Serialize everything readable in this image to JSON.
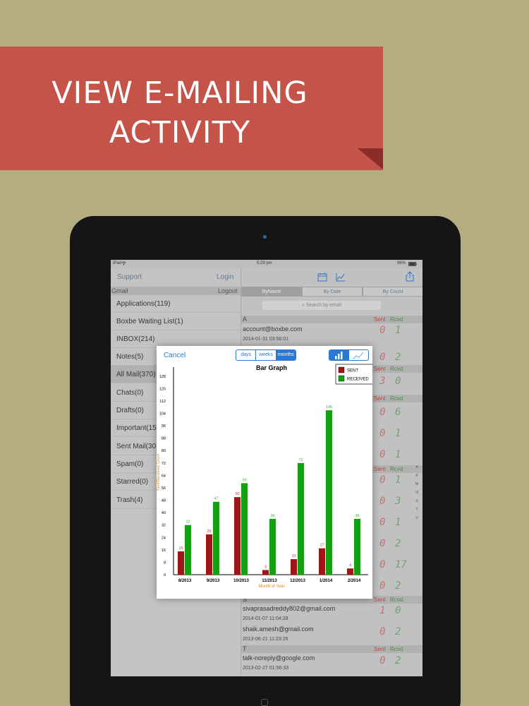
{
  "banner": {
    "line1": "VIEW E-MAILING",
    "line2": "ACTIVITY"
  },
  "status": {
    "device": "iPad",
    "time": "5:29 pm",
    "battery": "96%"
  },
  "left": {
    "support": "Support",
    "login": "Login",
    "account": "Gmail",
    "logout": "Logout",
    "folders": [
      "Applications(119)",
      "Boxbe Waiting List(1)",
      "INBOX(214)",
      "Notes(5)",
      "All Mail(370)",
      "Chats(0)",
      "Drafts(0)",
      "Important(15",
      "Sent Mail(30",
      "Spam(0)",
      "Starred(0)",
      "Trash(4)"
    ]
  },
  "right": {
    "tabs": [
      "ByName",
      "By Date",
      "By Count"
    ],
    "search_placeholder": "Search by email",
    "sent_label": "Sent",
    "rcvd_label": "Rcvd",
    "sections": [
      {
        "letter": "A",
        "email": "account@boxbe.com",
        "date": "2014-01-31 03:56:01",
        "sent": "0",
        "rcvd": "1"
      },
      {
        "letter": "S",
        "email": "sivaprasadreddy802@gmail.com",
        "date": "2014-01-07 11:04:28",
        "sent": "1",
        "rcvd": "0"
      },
      {
        "email": "shaik.amesh@gmail.com",
        "date": "2013-06-21 11:23:26",
        "sent": "0",
        "rcvd": "2"
      },
      {
        "letter": "T",
        "email": "talk-noreply@google.com",
        "date": "2013-02-27 01:56:33",
        "sent": "0",
        "rcvd": "2"
      }
    ],
    "hidden_counts": [
      {
        "sent": "0",
        "rcvd": "2"
      },
      {
        "sent": "3",
        "rcvd": "0"
      },
      {
        "sent": "0",
        "rcvd": "6"
      },
      {
        "sent": "0",
        "rcvd": "1"
      },
      {
        "sent": "0",
        "rcvd": "1"
      },
      {
        "sent": "0",
        "rcvd": "1"
      },
      {
        "sent": "0",
        "rcvd": "3"
      },
      {
        "sent": "0",
        "rcvd": "1"
      },
      {
        "sent": "0",
        "rcvd": "2"
      },
      {
        "sent": "0",
        "rcvd": "17"
      },
      {
        "sent": "0",
        "rcvd": "2"
      }
    ],
    "alphabet": [
      "A",
      "K",
      "M",
      "N",
      "S",
      "T",
      "V"
    ]
  },
  "popup": {
    "cancel": "Cancel",
    "periods": [
      "days",
      "weeks",
      "months"
    ],
    "selected_period": "months",
    "selected_graph": "bar"
  },
  "chart_data": {
    "type": "bar",
    "title": "Bar Graph",
    "xlabel": "Month of Year",
    "ylabel": "Sent/Received Count",
    "categories": [
      "8/2013",
      "9/2013",
      "10/2013",
      "11/2013",
      "12/2013",
      "1/2014",
      "2/2014"
    ],
    "series": [
      {
        "name": "SENT",
        "color": "#a01515",
        "values": [
          15,
          26,
          50,
          3,
          10,
          17,
          4
        ]
      },
      {
        "name": "RECEIVED",
        "color": "#13a013",
        "values": [
          32,
          47,
          59,
          36,
          72,
          106,
          36
        ]
      }
    ],
    "yticks": [
      0,
      8,
      16,
      24,
      32,
      40,
      48,
      56,
      64,
      72,
      80,
      88,
      96,
      104,
      112,
      120,
      128
    ],
    "ylim": [
      0,
      132
    ],
    "legend": "top-right",
    "grid": false
  }
}
